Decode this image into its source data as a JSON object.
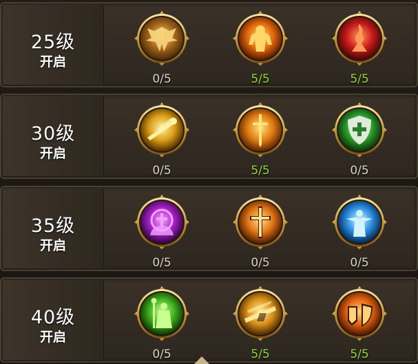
{
  "tiers": [
    {
      "level": "25级",
      "status": "开启",
      "skills": [
        {
          "icon": "winged-angel-icon",
          "progress": "0/5",
          "maxed": false,
          "colors": [
            "#f6d27a",
            "#a5661c",
            "#4a2a08"
          ]
        },
        {
          "icon": "fire-warrior-icon",
          "progress": "5/5",
          "maxed": true,
          "colors": [
            "#ffd86a",
            "#e36a0e",
            "#5a1a02"
          ]
        },
        {
          "icon": "flame-figure-icon",
          "progress": "5/5",
          "maxed": true,
          "colors": [
            "#ff9a5a",
            "#c81b1b",
            "#4a0505"
          ]
        }
      ]
    },
    {
      "level": "30级",
      "status": "开启",
      "skills": [
        {
          "icon": "golden-beam-icon",
          "progress": "0/5",
          "maxed": false,
          "colors": [
            "#fff3a8",
            "#d99c14",
            "#4d2c03"
          ]
        },
        {
          "icon": "holy-sword-icon",
          "progress": "5/5",
          "maxed": true,
          "colors": [
            "#ffe27a",
            "#e07c12",
            "#5a2403"
          ]
        },
        {
          "icon": "green-shield-icon",
          "progress": "0/5",
          "maxed": false,
          "colors": [
            "#b8ff8a",
            "#2c9e2c",
            "#0a300a"
          ]
        }
      ]
    },
    {
      "level": "35级",
      "status": "开启",
      "skills": [
        {
          "icon": "purple-mind-icon",
          "progress": "0/5",
          "maxed": false,
          "colors": [
            "#f3a0ff",
            "#a41fc4",
            "#2c0538"
          ]
        },
        {
          "icon": "holy-cross-icon",
          "progress": "0/5",
          "maxed": false,
          "colors": [
            "#ffe08a",
            "#e07414",
            "#4d1c02"
          ]
        },
        {
          "icon": "blue-priest-icon",
          "progress": "0/5",
          "maxed": false,
          "colors": [
            "#d2f4ff",
            "#2a8ee0",
            "#06234a"
          ]
        }
      ]
    },
    {
      "level": "40级",
      "status": "开启",
      "skills": [
        {
          "icon": "green-staff-icon",
          "progress": "0/5",
          "maxed": false,
          "colors": [
            "#c8ff90",
            "#3fae1e",
            "#0c3204"
          ]
        },
        {
          "icon": "golden-strike-icon",
          "progress": "5/5",
          "maxed": true,
          "colors": [
            "#fff0a0",
            "#d9901a",
            "#4a2604"
          ]
        },
        {
          "icon": "fire-shield-icon",
          "progress": "5/5",
          "maxed": true,
          "colors": [
            "#ffd27a",
            "#e3620e",
            "#4d1803"
          ]
        }
      ]
    }
  ]
}
